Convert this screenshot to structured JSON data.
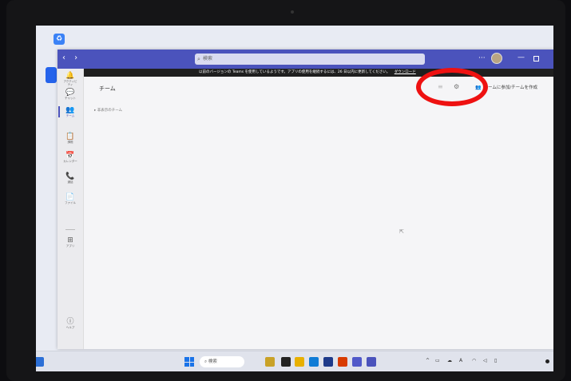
{
  "desktop": {
    "icon_label": ""
  },
  "titlebar": {
    "nav_arrows": "‹ ›",
    "search_placeholder": "検索",
    "search_icon": "search-icon",
    "more": "···",
    "minimize": "—"
  },
  "banner": {
    "text": "以前のバージョンの Teams を使用しているようです。アプリの使用を継続するには、26 日以内に更新してください。",
    "download_link": "ダウンロード"
  },
  "rail": {
    "items": [
      {
        "icon": "bell-icon",
        "glyph": "🔔",
        "label": "アクティビティ"
      },
      {
        "icon": "chat-icon",
        "glyph": "💬",
        "label": "チャット"
      },
      {
        "icon": "teams-icon",
        "glyph": "👥",
        "label": "チーム"
      },
      {
        "icon": "assignments-icon",
        "glyph": "📋",
        "label": "課題"
      },
      {
        "icon": "calendar-icon",
        "glyph": "📅",
        "label": "カレンダー"
      },
      {
        "icon": "calls-icon",
        "glyph": "📞",
        "label": "通話"
      },
      {
        "icon": "files-icon",
        "glyph": "📄",
        "label": "ファイル"
      },
      {
        "icon": "apps-icon",
        "glyph": "⊞",
        "label": "アプリ"
      },
      {
        "icon": "help-icon",
        "glyph": "?",
        "label": "ヘルプ"
      }
    ]
  },
  "main": {
    "title": "チーム",
    "join_create": "チームに参加/チームを作成",
    "team_group": "▸ 非表示のチーム"
  },
  "taskbar": {
    "search_placeholder": "検索",
    "clock_time": "",
    "clock_date": ""
  },
  "colors": {
    "teams_purple": "#4b53bc",
    "highlight_red": "#ee1111"
  }
}
